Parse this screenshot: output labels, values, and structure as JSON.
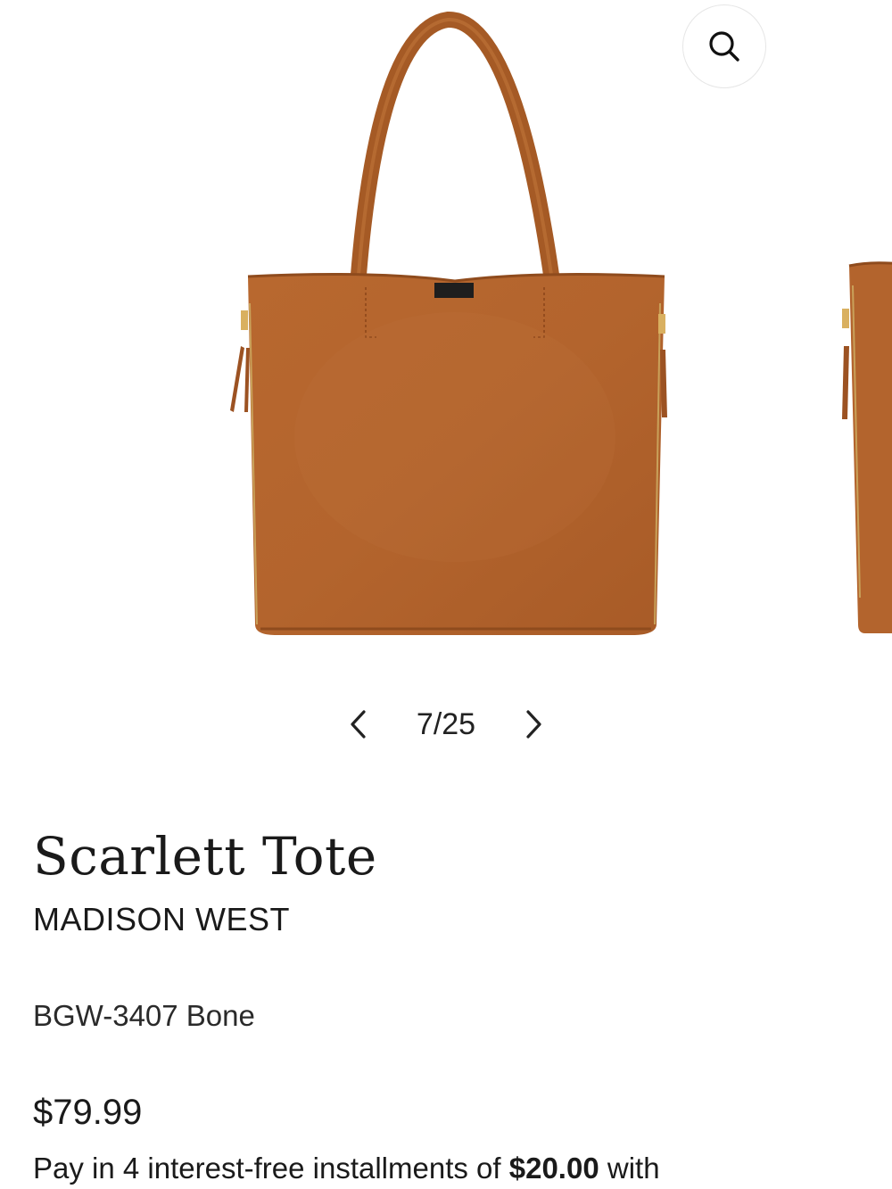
{
  "gallery": {
    "image_alt": "Scarlett Tote brown leather tote bag",
    "zoom_icon": "search-icon",
    "pager": {
      "current": "7/25",
      "prev_icon": "chevron-left-icon",
      "next_icon": "chevron-right-icon"
    }
  },
  "product": {
    "title": "Scarlett Tote",
    "brand": "MADISON WEST",
    "sku": "BGW-3407 Bone",
    "price": "$79.99",
    "installments": {
      "prefix": "Pay in 4 interest-free installments of ",
      "amount": "$20.00",
      "suffix": " with"
    }
  },
  "colors": {
    "bag_leather": "#b5652f",
    "bag_shadow": "#8e4a1f",
    "text": "#1a1a1a"
  }
}
